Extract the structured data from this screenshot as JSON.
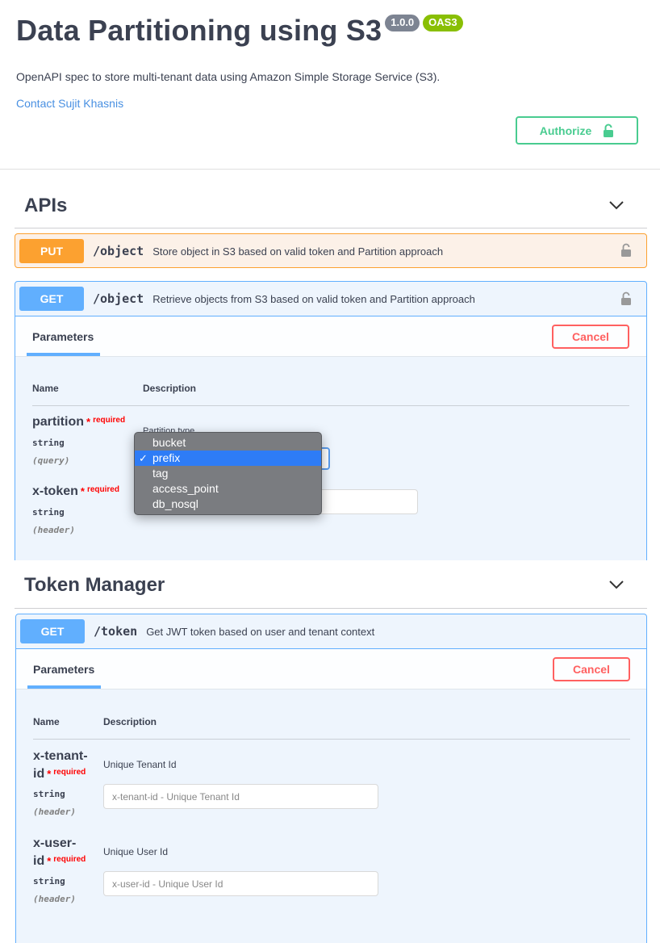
{
  "info": {
    "title": "Data Partitioning using S3",
    "version": "1.0.0",
    "oas": "OAS3",
    "description": "OpenAPI spec to store multi-tenant data using Amazon Simple Storage Service (S3).",
    "contact": "Contact Sujit Khasnis",
    "authorize_label": "Authorize"
  },
  "colors": {
    "put": "#fca130",
    "get": "#61affe",
    "authorize": "#49cc90",
    "cancel": "#ff6060",
    "required": "#ff0000"
  },
  "sections": {
    "apis": {
      "title": "APIs",
      "operations": [
        {
          "method": "PUT",
          "path": "/object",
          "summary": "Store object in S3 based on valid token and Partition approach"
        },
        {
          "method": "GET",
          "path": "/object",
          "summary": "Retrieve objects from S3 based on valid token and Partition approach"
        }
      ],
      "get_panel": {
        "tab": "Parameters",
        "cancel": "Cancel",
        "col_name": "Name",
        "col_desc": "Description",
        "params": [
          {
            "name": "partition",
            "star": "*",
            "required": "required",
            "type": "string",
            "in": "(query)",
            "description": "Partition type"
          },
          {
            "name": "x-token",
            "star": "*",
            "required": "required",
            "type": "string",
            "in": "(header)"
          }
        ],
        "dropdown": {
          "options": [
            "bucket",
            "prefix",
            "tag",
            "access_point",
            "db_nosql"
          ],
          "selected": "prefix",
          "check": "✓"
        }
      }
    },
    "token_manager": {
      "title": "Token Manager",
      "operations": [
        {
          "method": "GET",
          "path": "/token",
          "summary": "Get JWT token based on user and tenant context"
        }
      ],
      "get_panel": {
        "tab": "Parameters",
        "cancel": "Cancel",
        "col_name": "Name",
        "col_desc": "Description",
        "params": [
          {
            "name_line1": "x-tenant-",
            "name_line2": "id",
            "star": "*",
            "required": "required",
            "type": "string",
            "in": "(header)",
            "description": "Unique Tenant Id",
            "placeholder": "x-tenant-id - Unique Tenant Id"
          },
          {
            "name_line1": "x-user-",
            "name_line2": "id",
            "star": "*",
            "required": "required",
            "type": "string",
            "in": "(header)",
            "description": "Unique User Id",
            "placeholder": "x-user-id - Unique User Id"
          }
        ]
      }
    }
  },
  "icons": {
    "authorize": "unlock-icon",
    "operation_lock": "lock-icon",
    "section_toggle": "chevron-down-icon"
  }
}
